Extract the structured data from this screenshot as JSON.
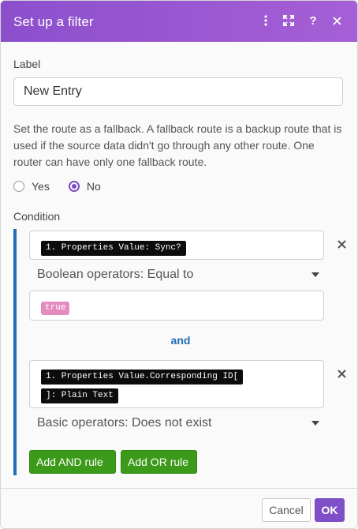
{
  "dialog": {
    "title": "Set up a filter"
  },
  "header_icons": [
    "more-vertical-icon",
    "expand-icon",
    "help-icon",
    "close-icon"
  ],
  "label_field": {
    "label": "Label",
    "value": "New Entry"
  },
  "fallback": {
    "description": "Set the route as a fallback. A fallback route is a backup route that is used if the source data didn't go through any other route. One router can have only one fallback route.",
    "options": [
      {
        "label": "Yes",
        "selected": false
      },
      {
        "label": "No",
        "selected": true
      }
    ]
  },
  "condition": {
    "label": "Condition",
    "rules": [
      {
        "field_tokens": [
          "1. Properties Value: Sync?"
        ],
        "operator": "Boolean operators: Equal to",
        "value_token": "true"
      },
      {
        "field_tokens": [
          "1. Properties Value.Corresponding ID[",
          "]: Plain Text"
        ],
        "operator": "Basic operators: Does not exist"
      }
    ],
    "connector": "and",
    "add_and_label": "Add AND rule",
    "add_or_label": "Add OR rule"
  },
  "footer": {
    "cancel_label": "Cancel",
    "ok_label": "OK"
  },
  "colors": {
    "header_purple": "#8c4fcc",
    "accent_blue": "#1f6fb8",
    "button_green": "#3c9a1a",
    "ok_purple": "#7f4fc7",
    "token_pink": "#e48cc0"
  }
}
